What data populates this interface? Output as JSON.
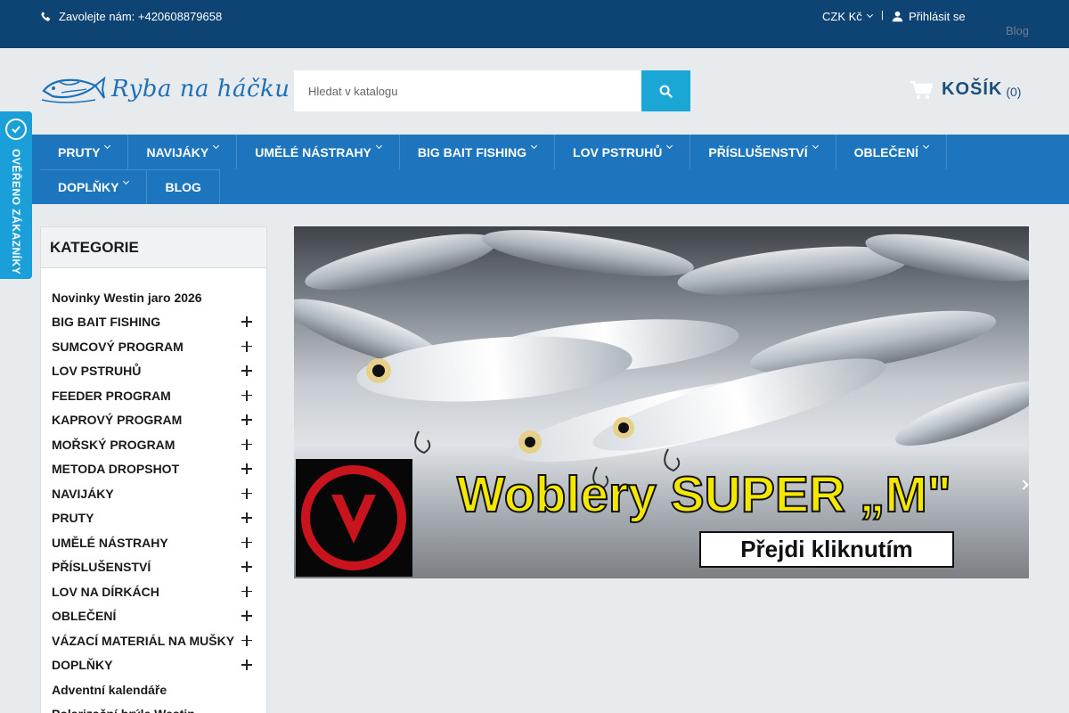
{
  "topbar": {
    "phone_text": "Zavolejte nám: +420608879658",
    "currency": "CZK Kč",
    "separator": "|",
    "login_label": "Přihlásit se"
  },
  "header": {
    "blog_link": "Blog",
    "logo_text": "Ryba na háčku",
    "search_placeholder": "Hledat v katalogu",
    "cart_label": "KOŠÍK",
    "cart_count": "(0)"
  },
  "nav": {
    "row1": [
      {
        "label": "PRUTY",
        "dropdown": true
      },
      {
        "label": "NAVIJÁKY",
        "dropdown": true
      },
      {
        "label": "UMĚLÉ NÁSTRAHY",
        "dropdown": true
      },
      {
        "label": "BIG BAIT FISHING",
        "dropdown": true
      },
      {
        "label": "LOV PSTRUHŮ",
        "dropdown": true
      },
      {
        "label": "PŘÍSLUŠENSTVÍ",
        "dropdown": true
      },
      {
        "label": "OBLEČENÍ",
        "dropdown": true
      }
    ],
    "row2": [
      {
        "label": "DOPLŇKY",
        "dropdown": true
      },
      {
        "label": "BLOG",
        "dropdown": false
      }
    ]
  },
  "badge": {
    "text": "OVĚŘENO ZÁKAZNÍKY",
    "icon": "verified-shop-icon"
  },
  "categories": {
    "title": "KATEGORIE",
    "items": [
      {
        "label": "Novinky Westin jaro 2026",
        "expandable": false
      },
      {
        "label": "BIG BAIT FISHING",
        "expandable": true
      },
      {
        "label": "SUMCOVÝ PROGRAM",
        "expandable": true
      },
      {
        "label": "LOV PSTRUHŮ",
        "expandable": true
      },
      {
        "label": "FEEDER PROGRAM",
        "expandable": true
      },
      {
        "label": "KAPROVÝ PROGRAM",
        "expandable": true
      },
      {
        "label": "MOŘSKÝ PROGRAM",
        "expandable": true
      },
      {
        "label": "METODA DROPSHOT",
        "expandable": true
      },
      {
        "label": "NAVIJÁKY",
        "expandable": true
      },
      {
        "label": "PRUTY",
        "expandable": true
      },
      {
        "label": "UMĚLÉ NÁSTRAHY",
        "expandable": true
      },
      {
        "label": "PŘÍSLUŠENSTVÍ",
        "expandable": true
      },
      {
        "label": "LOV NA DÍRKÁCH",
        "expandable": true
      },
      {
        "label": "OBLEČENÍ",
        "expandable": true
      },
      {
        "label": "VÁZACÍ MATERIÁL NA MUŠKY",
        "expandable": true
      },
      {
        "label": "DOPLŇKY",
        "expandable": true
      },
      {
        "label": "Adventní kalendáře",
        "expandable": false
      },
      {
        "label": "Polarizační brýle Westin",
        "expandable": false
      }
    ]
  },
  "banner": {
    "title": "Woblery SUPER „M\"",
    "cta": "Přejdi kliknutím"
  },
  "colors": {
    "topbar": "#0d4473",
    "nav": "#1d75be",
    "accent": "#1ba7d6",
    "badge": "#1b9fd8"
  }
}
